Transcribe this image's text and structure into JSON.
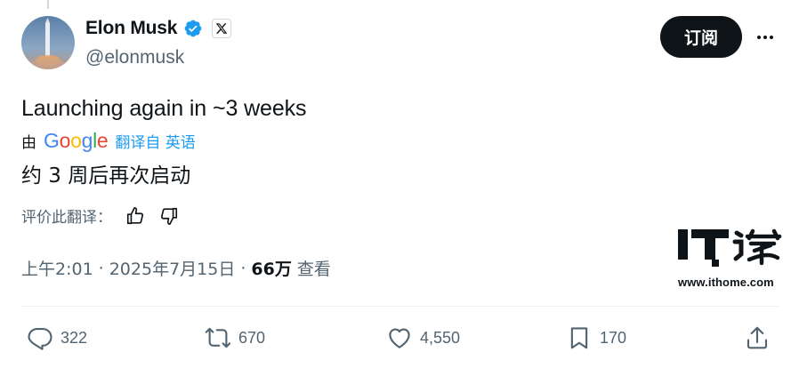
{
  "author": {
    "display_name": "Elon Musk",
    "handle": "@elonmusk"
  },
  "header_actions": {
    "subscribe_label": "订阅"
  },
  "tweet": {
    "text": "Launching again in ~3 weeks",
    "translation": {
      "by_label": "由",
      "provider": "Google",
      "from_label": "翻译自 英语",
      "text": "约 3 周后再次启动"
    },
    "rate_label": "评价此翻译："
  },
  "meta": {
    "time": "上午2:01",
    "separator": "·",
    "date": "2025年7月15日",
    "views_count": "66万",
    "views_label": "查看"
  },
  "actions": {
    "replies": "322",
    "retweets": "670",
    "likes": "4,550",
    "bookmarks": "170"
  },
  "watermark": {
    "url": "www.ithome.com"
  },
  "colors": {
    "text_primary": "#0f1419",
    "text_secondary": "#536471",
    "link_blue": "#1d9bf0",
    "verified_blue": "#1d9bf0",
    "divider": "#eff3f4",
    "button_dark": "#0f1419"
  },
  "icons": {
    "verified": "verified-badge-icon",
    "x_logo": "x-logo-icon",
    "more": "more-horizontal-icon",
    "thumbs_up": "thumbs-up-icon",
    "thumbs_down": "thumbs-down-icon",
    "reply": "reply-icon",
    "retweet": "retweet-icon",
    "like": "heart-icon",
    "bookmark": "bookmark-icon",
    "share": "share-icon"
  }
}
